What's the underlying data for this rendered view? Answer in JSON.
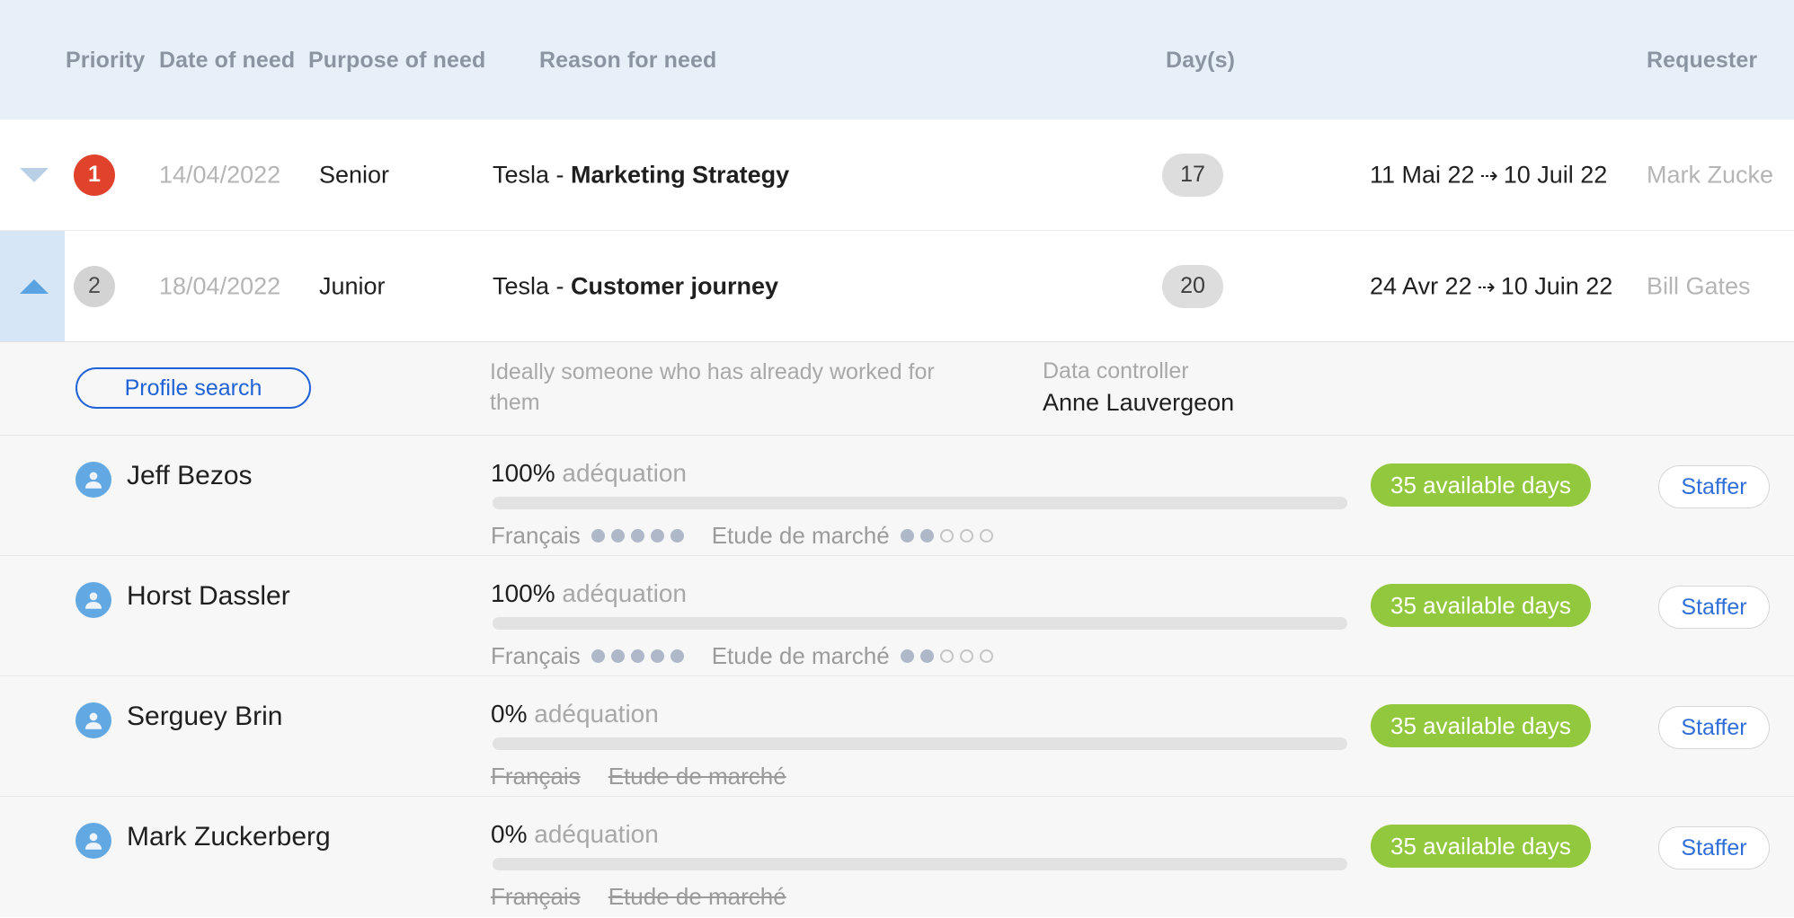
{
  "table": {
    "columns": [
      {
        "key": "priority",
        "label": "Priority"
      },
      {
        "key": "date",
        "label": "Date of need"
      },
      {
        "key": "purpose",
        "label": "Purpose of need"
      },
      {
        "key": "reason",
        "label": "Reason for need"
      },
      {
        "key": "days",
        "label": "Day(s)"
      },
      {
        "key": "requester",
        "label": "Requester"
      }
    ],
    "rows": [
      {
        "caret_icon": "chevron-down-icon",
        "expanded": false,
        "priority": "1",
        "priority_style": "red",
        "date": "14/04/2022",
        "purpose": "Senior",
        "reason_prefix": "Tesla - ",
        "reason_bold": "Marketing Strategy",
        "days": "17",
        "range_start": "11 Mai 22",
        "range_arrow": "⇢",
        "range_end": "10 Juil 22",
        "requester": "Mark Zucke"
      },
      {
        "caret_icon": "chevron-up-icon",
        "expanded": true,
        "priority": "2",
        "priority_style": "grey",
        "date": "18/04/2022",
        "purpose": "Junior",
        "reason_prefix": "Tesla - ",
        "reason_bold": "Customer journey",
        "days": "20",
        "range_start": "24 Avr 22",
        "range_arrow": "⇢",
        "range_end": "10 Juin 22",
        "requester": "Bill Gates"
      }
    ]
  },
  "panel": {
    "profile_search_label": "Profile search",
    "note": "Ideally someone who has already worked for them",
    "data_controller_label": "Data controller",
    "data_controller_value": "Anne Lauvergeon",
    "adequation_label": "adéquation",
    "candidates": [
      {
        "avatar_icon": "user-avatar-icon",
        "name": "Jeff Bezos",
        "percent": "100%",
        "percent_value": 100,
        "skills": [
          {
            "name": "Français",
            "filled": 5,
            "total": 5,
            "struck": false
          },
          {
            "name": "Etude de marché",
            "filled": 2,
            "total": 5,
            "struck": false
          }
        ],
        "availability": "35 available days",
        "staffer_label": "Staffer"
      },
      {
        "avatar_icon": "user-avatar-icon",
        "name": "Horst Dassler",
        "percent": "100%",
        "percent_value": 100,
        "skills": [
          {
            "name": "Français",
            "filled": 5,
            "total": 5,
            "struck": false
          },
          {
            "name": "Etude de marché",
            "filled": 2,
            "total": 5,
            "struck": false
          }
        ],
        "availability": "35 available days",
        "staffer_label": "Staffer"
      },
      {
        "avatar_icon": "user-avatar-icon",
        "name": "Serguey Brin",
        "percent": "0%",
        "percent_value": 0,
        "skills": [
          {
            "name": "Français",
            "filled": 0,
            "total": 0,
            "struck": true
          },
          {
            "name": "Etude de marché",
            "filled": 0,
            "total": 0,
            "struck": true
          }
        ],
        "availability": "35 available days",
        "staffer_label": "Staffer"
      },
      {
        "avatar_icon": "user-avatar-icon",
        "name": "Mark Zuckerberg",
        "percent": "0%",
        "percent_value": 0,
        "skills": [
          {
            "name": "Français",
            "filled": 0,
            "total": 0,
            "struck": true
          },
          {
            "name": "Etude de marché",
            "filled": 0,
            "total": 0,
            "struck": true
          }
        ],
        "availability": "35 available days",
        "staffer_label": "Staffer"
      }
    ]
  },
  "colors": {
    "header_bg": "#e7eff9",
    "priority_red": "#e0422b",
    "priority_grey": "#d3d3d3",
    "accent_blue": "#1f63d6",
    "bar_blue": "#5b9bd5",
    "available_green": "#92c83e",
    "panel_bg": "#f7f7f7"
  }
}
